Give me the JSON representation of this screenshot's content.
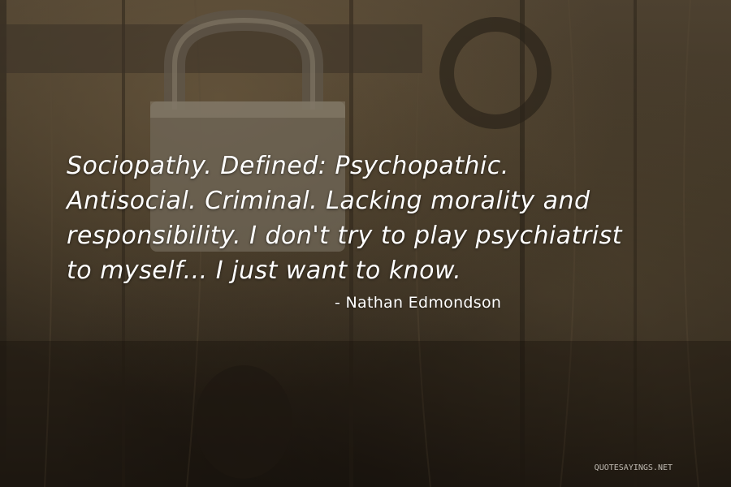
{
  "quote": {
    "lines": [
      "Sociopathy. Defined: Psychopathic.",
      "Antisocial. Criminal. Lacking morality and",
      "responsibility. I don't try to play psychiatrist",
      "to myself... I just want to know."
    ]
  },
  "author": "- Nathan Edmondson",
  "watermark": "QUOTESAYINGS.NET",
  "colors": {
    "text": "#ffffff",
    "background": "#3d3324"
  }
}
